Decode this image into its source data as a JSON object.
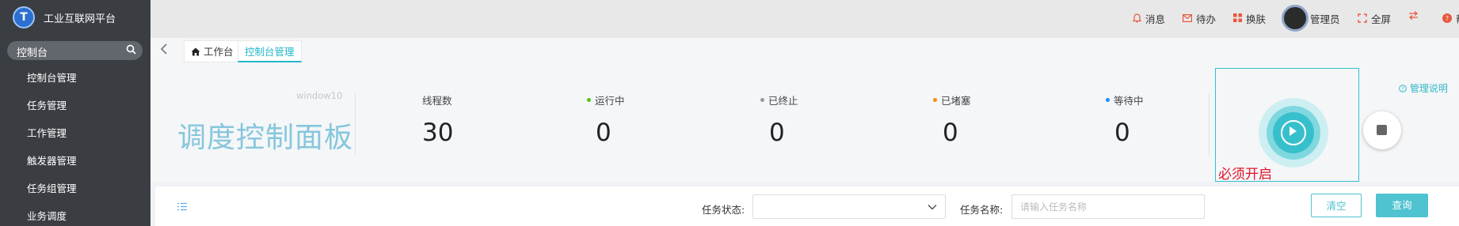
{
  "app": {
    "logo_glyph": "T",
    "title": "工业互联网平台"
  },
  "sidebar": {
    "search_text": "控制台",
    "items": [
      {
        "label": "控制台管理"
      },
      {
        "label": "任务管理"
      },
      {
        "label": "工作管理"
      },
      {
        "label": "触发器管理"
      },
      {
        "label": "任务组管理"
      },
      {
        "label": "业务调度"
      }
    ]
  },
  "topbar": {
    "items": [
      {
        "icon": "bell-icon",
        "label": "消息"
      },
      {
        "icon": "mail-icon",
        "label": "待办"
      },
      {
        "icon": "grid-icon",
        "label": "换肤"
      },
      {
        "icon": "avatar",
        "label": "管理员"
      },
      {
        "icon": "fullscreen-icon",
        "label": "全屏"
      },
      {
        "icon": "swap-icon",
        "label": ""
      },
      {
        "icon": "help-circle-icon",
        "label": "帮"
      }
    ]
  },
  "tabs": [
    {
      "label": "工作台",
      "icon": "home-icon"
    },
    {
      "label": "控制台管理",
      "active": true
    }
  ],
  "dashboard": {
    "os": "window10",
    "title": "调度控制面板",
    "stats": [
      {
        "label": "线程数",
        "value": "30",
        "dot_color": ""
      },
      {
        "label": "运行中",
        "value": "0",
        "dot_color": "#52c41a"
      },
      {
        "label": "已终止",
        "value": "0",
        "dot_color": "#999999"
      },
      {
        "label": "已堵塞",
        "value": "0",
        "dot_color": "#fa8c16"
      },
      {
        "label": "等待中",
        "value": "0",
        "dot_color": "#1890ff"
      }
    ],
    "must_start": "必须开启",
    "help": "管理说明"
  },
  "filter": {
    "status_label": "任务状态:",
    "status_value": "",
    "name_label": "任务名称:",
    "name_placeholder": "请输入任务名称",
    "clear_label": "清空",
    "query_label": "查询"
  },
  "colors": {
    "accent": "#4fc3cf",
    "sidebar": "#3a3d42",
    "warning_text": "#e0162b"
  }
}
